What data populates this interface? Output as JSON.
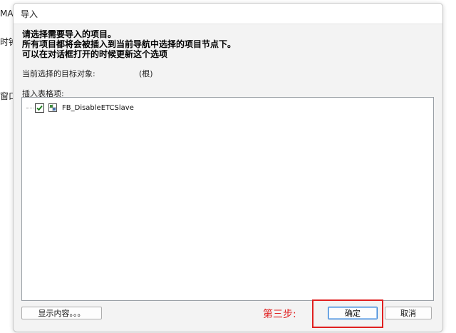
{
  "background": {
    "fragments": [
      "MA",
      "时钟",
      "窗口"
    ]
  },
  "dialog": {
    "title": "导入",
    "instructions": [
      "请选择需要导入的项目。",
      "所有项目都将会被插入到当前导航中选择的项目节点下。",
      "可以在对话框打开的时候更新这个选项"
    ],
    "target_label": "当前选择的目标对象:",
    "target_value": "(根)",
    "insert_label": "插入表格项:",
    "tree": {
      "items": [
        {
          "label": "FB_DisableETCSlave",
          "checked": true,
          "icon": "function-block-icon"
        }
      ]
    },
    "buttons": {
      "show_content": "显示内容。。。",
      "ok": "确定",
      "cancel": "取消"
    },
    "annotation": {
      "step_text": "第三步:",
      "color": "#e02020"
    }
  }
}
